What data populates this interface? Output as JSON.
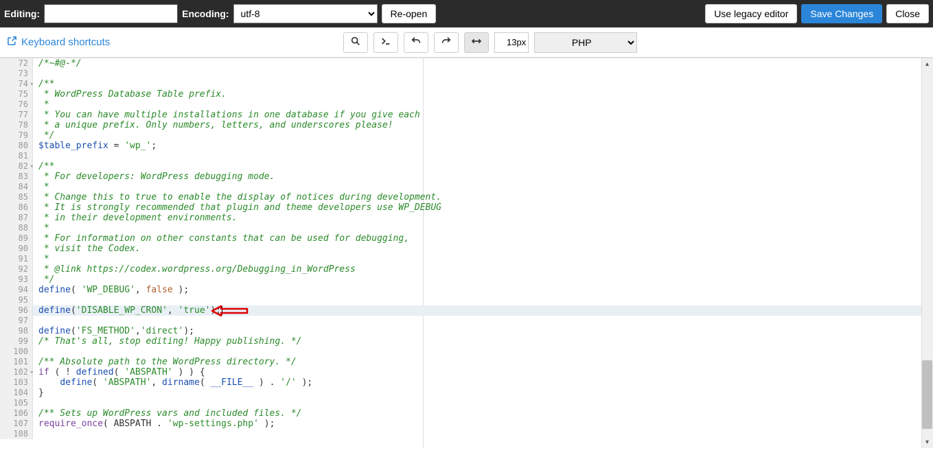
{
  "topbar": {
    "editing_label": "Editing:",
    "editing_value": "",
    "encoding_label": "Encoding:",
    "encoding_value": "utf-8",
    "reopen": "Re-open",
    "legacy": "Use legacy editor",
    "save": "Save Changes",
    "close": "Close"
  },
  "toolbar": {
    "kbd": "Keyboard shortcuts",
    "font_size": "13px",
    "language": "PHP"
  },
  "editor": {
    "highlighted_line": 96,
    "lines": [
      {
        "n": 72,
        "tokens": [
          {
            "t": "/*~#@-*/",
            "c": "comment"
          }
        ]
      },
      {
        "n": 73,
        "tokens": []
      },
      {
        "n": 74,
        "fold": true,
        "tokens": [
          {
            "t": "/**",
            "c": "comment"
          }
        ]
      },
      {
        "n": 75,
        "tokens": [
          {
            "t": " * WordPress Database Table prefix.",
            "c": "comment"
          }
        ]
      },
      {
        "n": 76,
        "tokens": [
          {
            "t": " *",
            "c": "comment"
          }
        ]
      },
      {
        "n": 77,
        "tokens": [
          {
            "t": " * You can have multiple installations in one database if you give each",
            "c": "comment"
          }
        ]
      },
      {
        "n": 78,
        "tokens": [
          {
            "t": " * a unique prefix. Only numbers, letters, and underscores please!",
            "c": "comment"
          }
        ]
      },
      {
        "n": 79,
        "tokens": [
          {
            "t": " */",
            "c": "comment"
          }
        ]
      },
      {
        "n": 80,
        "tokens": [
          {
            "t": "$table_prefix",
            "c": "var"
          },
          {
            "t": " = ",
            "c": "op"
          },
          {
            "t": "'wp_'",
            "c": "str"
          },
          {
            "t": ";",
            "c": "op"
          }
        ]
      },
      {
        "n": 81,
        "tokens": []
      },
      {
        "n": 82,
        "fold": true,
        "tokens": [
          {
            "t": "/**",
            "c": "comment"
          }
        ]
      },
      {
        "n": 83,
        "tokens": [
          {
            "t": " * For developers: WordPress debugging mode.",
            "c": "comment"
          }
        ]
      },
      {
        "n": 84,
        "tokens": [
          {
            "t": " *",
            "c": "comment"
          }
        ]
      },
      {
        "n": 85,
        "tokens": [
          {
            "t": " * Change this to true to enable the display of notices during development.",
            "c": "comment"
          }
        ]
      },
      {
        "n": 86,
        "tokens": [
          {
            "t": " * It is strongly recommended that plugin and theme developers use WP_DEBUG",
            "c": "comment"
          }
        ]
      },
      {
        "n": 87,
        "tokens": [
          {
            "t": " * in their development environments.",
            "c": "comment"
          }
        ]
      },
      {
        "n": 88,
        "tokens": [
          {
            "t": " *",
            "c": "comment"
          }
        ]
      },
      {
        "n": 89,
        "tokens": [
          {
            "t": " * For information on other constants that can be used for debugging,",
            "c": "comment"
          }
        ]
      },
      {
        "n": 90,
        "tokens": [
          {
            "t": " * visit the Codex.",
            "c": "comment"
          }
        ]
      },
      {
        "n": 91,
        "tokens": [
          {
            "t": " *",
            "c": "comment"
          }
        ]
      },
      {
        "n": 92,
        "tokens": [
          {
            "t": " * @link https://codex.wordpress.org/Debugging_in_WordPress",
            "c": "comment"
          }
        ]
      },
      {
        "n": 93,
        "tokens": [
          {
            "t": " */",
            "c": "comment"
          }
        ]
      },
      {
        "n": 94,
        "tokens": [
          {
            "t": "define",
            "c": "func"
          },
          {
            "t": "( ",
            "c": "paren"
          },
          {
            "t": "'WP_DEBUG'",
            "c": "str"
          },
          {
            "t": ", ",
            "c": "op"
          },
          {
            "t": "false",
            "c": "bool"
          },
          {
            "t": " );",
            "c": "paren"
          }
        ]
      },
      {
        "n": 95,
        "tokens": []
      },
      {
        "n": 96,
        "tokens": [
          {
            "t": "define",
            "c": "func"
          },
          {
            "t": "(",
            "c": "paren"
          },
          {
            "t": "'DISABLE_WP_CRON'",
            "c": "str"
          },
          {
            "t": ", ",
            "c": "op"
          },
          {
            "t": "'true'",
            "c": "str"
          },
          {
            "t": ");",
            "c": "paren"
          }
        ],
        "cursor": true
      },
      {
        "n": 97,
        "tokens": []
      },
      {
        "n": 98,
        "tokens": [
          {
            "t": "define",
            "c": "func"
          },
          {
            "t": "(",
            "c": "paren"
          },
          {
            "t": "'FS_METHOD'",
            "c": "str"
          },
          {
            "t": ",",
            "c": "op"
          },
          {
            "t": "'direct'",
            "c": "str"
          },
          {
            "t": ");",
            "c": "paren"
          }
        ]
      },
      {
        "n": 99,
        "tokens": [
          {
            "t": "/* That's all, stop editing! Happy publishing. */",
            "c": "comment"
          }
        ]
      },
      {
        "n": 100,
        "tokens": []
      },
      {
        "n": 101,
        "tokens": [
          {
            "t": "/** Absolute path to the WordPress directory. */",
            "c": "comment"
          }
        ]
      },
      {
        "n": 102,
        "fold": true,
        "tokens": [
          {
            "t": "if",
            "c": "kw"
          },
          {
            "t": " ( ! ",
            "c": "op"
          },
          {
            "t": "defined",
            "c": "func"
          },
          {
            "t": "( ",
            "c": "paren"
          },
          {
            "t": "'ABSPATH'",
            "c": "str"
          },
          {
            "t": " ) ) {",
            "c": "paren"
          }
        ]
      },
      {
        "n": 103,
        "tokens": [
          {
            "t": "    ",
            "c": "op"
          },
          {
            "t": "define",
            "c": "func"
          },
          {
            "t": "( ",
            "c": "paren"
          },
          {
            "t": "'ABSPATH'",
            "c": "str"
          },
          {
            "t": ", ",
            "c": "op"
          },
          {
            "t": "dirname",
            "c": "func"
          },
          {
            "t": "( ",
            "c": "paren"
          },
          {
            "t": "__FILE__",
            "c": "const"
          },
          {
            "t": " ) . ",
            "c": "op"
          },
          {
            "t": "'/'",
            "c": "str"
          },
          {
            "t": " );",
            "c": "paren"
          }
        ]
      },
      {
        "n": 104,
        "tokens": [
          {
            "t": "}",
            "c": "paren"
          }
        ]
      },
      {
        "n": 105,
        "tokens": []
      },
      {
        "n": 106,
        "tokens": [
          {
            "t": "/** Sets up WordPress vars and included files. */",
            "c": "comment"
          }
        ]
      },
      {
        "n": 107,
        "tokens": [
          {
            "t": "require_once",
            "c": "kw"
          },
          {
            "t": "( ",
            "c": "paren"
          },
          {
            "t": "ABSPATH ",
            "c": "op"
          },
          {
            "t": ". ",
            "c": "op"
          },
          {
            "t": "'wp-settings.php'",
            "c": "str"
          },
          {
            "t": " );",
            "c": "paren"
          }
        ]
      },
      {
        "n": 108,
        "tokens": []
      }
    ]
  }
}
